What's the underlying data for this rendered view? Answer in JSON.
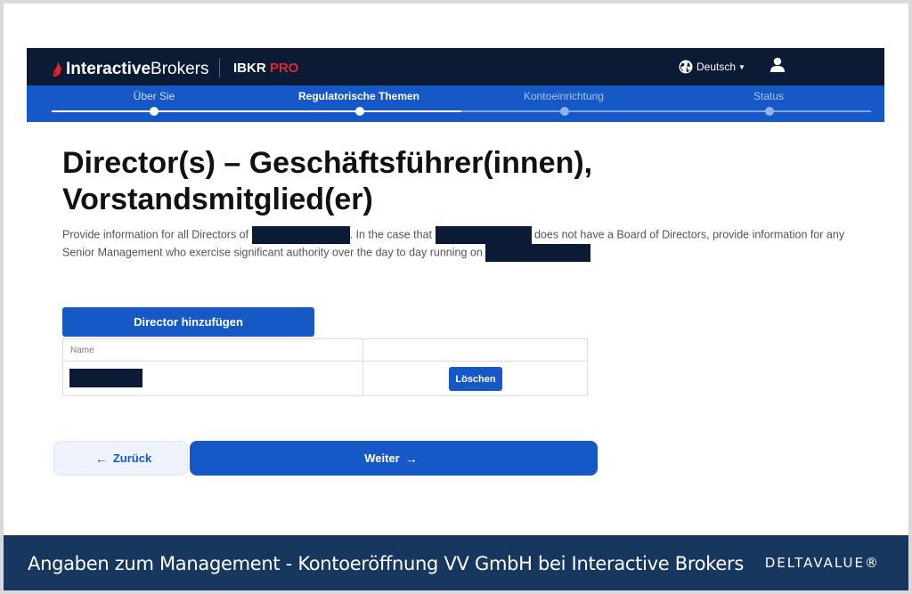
{
  "header": {
    "logo_bold": "Interactive",
    "logo_regular": "Brokers",
    "product_prefix": "IBKR ",
    "product_accent": "PRO",
    "language": "Deutsch",
    "colors": {
      "navbar": "#0b1a35",
      "brand_red": "#e0272f"
    }
  },
  "stepper": {
    "steps": [
      {
        "label": "Über Sie",
        "state": "done"
      },
      {
        "label": "Regulatorische Themen",
        "state": "active"
      },
      {
        "label": "Kontoeinrichtung",
        "state": "pending"
      },
      {
        "label": "Status",
        "state": "pending"
      }
    ],
    "color": "#1658c6"
  },
  "page": {
    "title_line1": "Director(s) – Geschäftsführer(innen),",
    "title_line2": "Vorstandsmitglied(er)",
    "desc_part1": "Provide information for all Directors of",
    "desc_part2": ". In the case that",
    "desc_part3": "does not have a Board of Directors, provide information for any Senior Management who exercise significant authority over the day to day running on"
  },
  "directors": {
    "add_button": "Director hinzufügen",
    "column_name": "Name",
    "delete_button": "Löschen"
  },
  "nav": {
    "back_label": "Zurück",
    "next_label": "Weiter"
  },
  "footer": {
    "caption": "Angaben zum Management - Kontoeröffnung VV GmbH bei Interactive Brokers",
    "brand": "DELTAVALUE®",
    "background": "#17375e"
  }
}
